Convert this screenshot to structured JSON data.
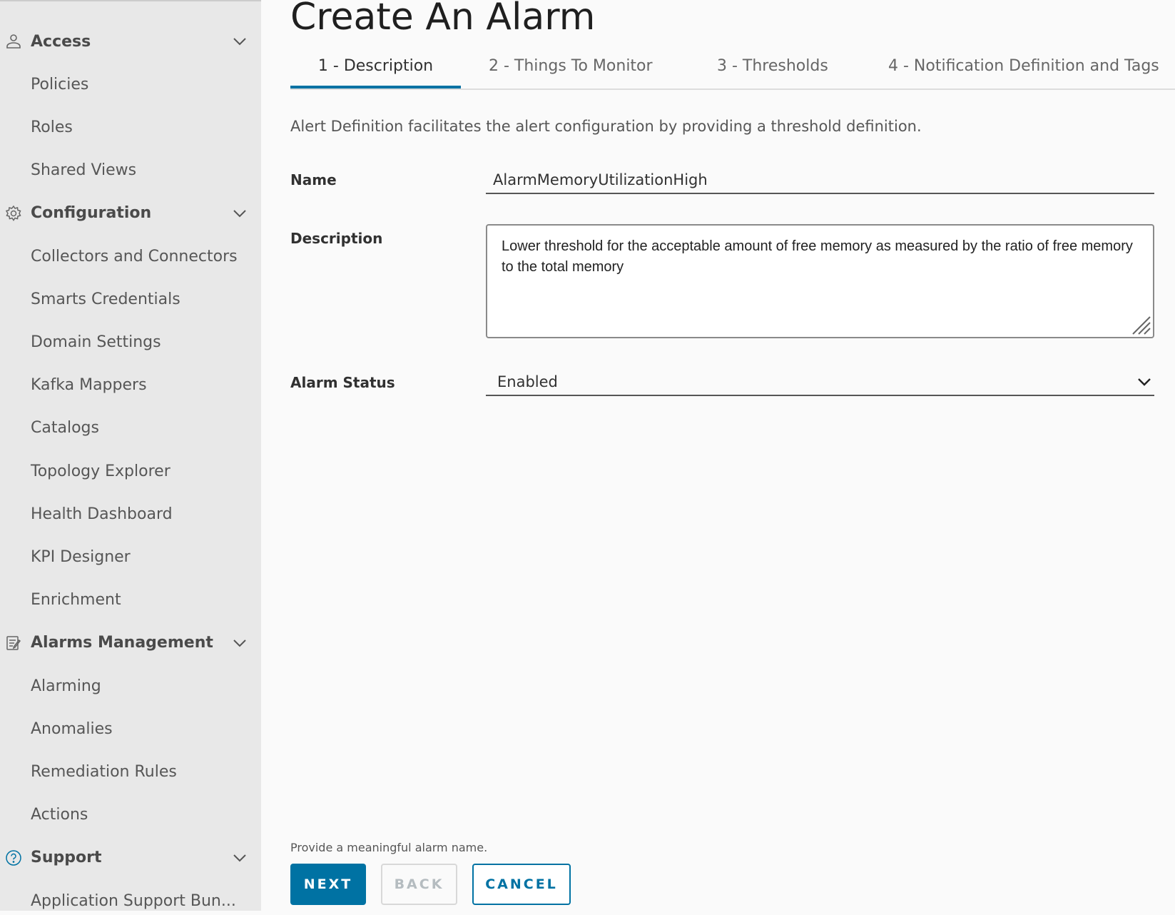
{
  "sidebar": {
    "sections": [
      {
        "label": "Access",
        "icon": "user-icon",
        "items": [
          "Policies",
          "Roles",
          "Shared Views"
        ]
      },
      {
        "label": "Configuration",
        "icon": "gear-icon",
        "items": [
          "Collectors and Connectors",
          "Smarts Credentials",
          "Domain Settings",
          "Kafka Mappers",
          "Catalogs",
          "Topology Explorer",
          "Health Dashboard",
          "KPI Designer",
          "Enrichment"
        ]
      },
      {
        "label": "Alarms Management",
        "icon": "notepad-icon",
        "items": [
          "Alarming",
          "Anomalies",
          "Remediation Rules",
          "Actions"
        ]
      },
      {
        "label": "Support",
        "icon": "help-circle-icon",
        "items": [
          "Application Support Bun..."
        ]
      }
    ]
  },
  "page": {
    "title": "Create An Alarm"
  },
  "tabs": [
    {
      "label": "1 - Description",
      "active": true
    },
    {
      "label": "2 - Things To Monitor"
    },
    {
      "label": "3 - Thresholds"
    },
    {
      "label": "4 - Notification Definition and Tags"
    }
  ],
  "form": {
    "intro": "Alert Definition facilitates the alert configuration by providing a threshold definition.",
    "name_label": "Name",
    "name_value": "AlarmMemoryUtilizationHigh",
    "description_label": "Description",
    "description_value": "Lower threshold for the acceptable amount of free memory as measured by the ratio of free memory to the total memory",
    "status_label": "Alarm Status",
    "status_value": "Enabled"
  },
  "footer": {
    "hint": "Provide a meaningful alarm name.",
    "next": "NEXT",
    "back": "BACK",
    "cancel": "CANCEL"
  },
  "colors": {
    "accent": "#0072a3",
    "sidebar_bg": "#e8e8e8"
  }
}
